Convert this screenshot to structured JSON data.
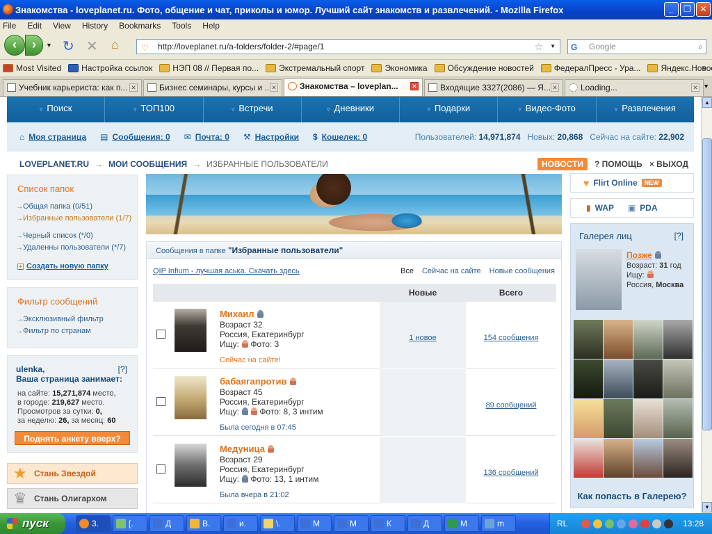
{
  "window": {
    "title": "Знакомства - loveplanet.ru. Фото, общение и чат, приколы и юмор. Лучший сайт знакомств и развлечений. - Mozilla Firefox"
  },
  "menu": [
    "File",
    "Edit",
    "View",
    "History",
    "Bookmarks",
    "Tools",
    "Help"
  ],
  "address": {
    "url": "http://loveplanet.ru/a-folders/folder-2/#page/1",
    "search_placeholder": "Google"
  },
  "bookmarks": [
    "Most Visited",
    "Настройка ссылок",
    "НЭП 08 // Первая по...",
    "Экстремальный спорт",
    "Экономика",
    "Обсуждение новостей",
    "ФедералПресс - Ура...",
    "Яндекс.Новости: Ек..."
  ],
  "tabs": [
    "Учебник карьериста: как п...",
    "Бизнес семинары, курсы и ...",
    "Знакомства – loveplan...",
    "Входящие 3327(2086) — Я...",
    "Loading..."
  ],
  "sitenav": [
    "Поиск",
    "ТОП100",
    "Встречи",
    "Дневники",
    "Подарки",
    "Видео-Фото",
    "Развлечения"
  ],
  "userbar": {
    "links": [
      "Моя страница",
      "Сообщения: 0",
      "Почта: 0",
      "Настройки",
      "Кошелек: 0"
    ],
    "users_label": "Пользователей:",
    "users": "14,971,874",
    "new_label": "Новых:",
    "new": "20,868",
    "online_label": "Сейчас на сайте:",
    "online": "22,902"
  },
  "breadcrumb": {
    "root": "LOVEPLANET.RU",
    "mid": "МОИ СООБЩЕНИЯ",
    "current": "ИЗБРАННЫЕ ПОЛЬЗОВАТЕЛИ",
    "news": "НОВОСТИ",
    "help": "? ПОМОЩЬ",
    "exit": "× ВЫХОД"
  },
  "folders": {
    "title": "Список папок",
    "items": [
      "Общая папка (0/51)",
      "Избранные пользователи (1/7)",
      "Черный список (*/0)",
      "Удаленны пользователи (*/7)"
    ],
    "create": "Создать новую папку"
  },
  "filter": {
    "title": "Фильтр сообщений",
    "items": [
      "Эксклюзивный фильтр",
      "Фильтр по странам"
    ]
  },
  "user": {
    "name": "ulenka,",
    "help": "[?]",
    "subtitle": "Ваша страница занимает:",
    "site_label": "на сайте:",
    "site_rank": "15,271,874",
    "site_suffix": "место,",
    "city_label": "в городе:",
    "city_rank": "219,627",
    "city_suffix": "место.",
    "views_label": "Просмотров за сутки:",
    "views_day": "0,",
    "week_label": "за неделю:",
    "week": "26,",
    "month_label": "за месяц:",
    "month": "60",
    "raise": "Поднять анкету вверх?"
  },
  "promo": {
    "star": "Стань Звездой",
    "oligarch": "Стань Олигархом"
  },
  "messages": {
    "header_prefix": "Сообщения в папке",
    "header_folder": "\"Избранные пользователи\"",
    "qip": "QIP Infium - лучшая аська. Скачать здесь",
    "filters": [
      "Все",
      "Сейчас на сайте",
      "Новые сообщения"
    ],
    "col_new": "Новые",
    "col_total": "Всего",
    "rows": [
      {
        "name": "Михаил",
        "age": "Возраст 32",
        "loc": "Россия, Екатеринбург",
        "seek": "Ищу:",
        "photos": "Фото: 3",
        "status": "Сейчас на сайте!",
        "status_color": "#e0741a",
        "new": "1 новое",
        "total": "154 сообщения"
      },
      {
        "name": "бабаягапротив",
        "age": "Возраст 45",
        "loc": "Россия, Екатеринбург",
        "seek": "Ищу:",
        "photos": "Фото: 8, 3 интим",
        "status": "Была сегодня в 07:45",
        "status_color": "#2d5f8f",
        "new": "",
        "total": "89 сообщений"
      },
      {
        "name": "Медуница",
        "age": "Возраст 29",
        "loc": "Россия, Екатеринбург",
        "seek": "Ищу:",
        "photos": "Фото: 13, 1 интим",
        "status": "Была вчера в 21:02",
        "status_color": "#2d5f8f",
        "new": "",
        "total": "136 сообщений"
      }
    ]
  },
  "right": {
    "flirt": "Flirt Online",
    "flirt_badge": "NEW",
    "wap": "WAP",
    "pda": "PDA",
    "gallery_title": "Галерея лиц",
    "gallery_help": "[?]",
    "featured": {
      "name": "Позже",
      "age_label": "Возраст:",
      "age": "31",
      "age_suffix": "год",
      "seek": "Ищу:",
      "country": "Россия,",
      "city": "Москва"
    },
    "how": "Как попасть в Галерею?"
  },
  "taskbar": {
    "start": "пуск",
    "items": [
      "3.",
      "[.",
      "Д",
      "В.",
      "и.",
      "\\.",
      "М",
      "М",
      "К",
      "Д",
      "М",
      "m"
    ],
    "lang": "RL",
    "clock": "13:28"
  },
  "colors": {
    "accent": "#e0741a",
    "nav": "#1a73b3",
    "link": "#2d5f8f"
  }
}
